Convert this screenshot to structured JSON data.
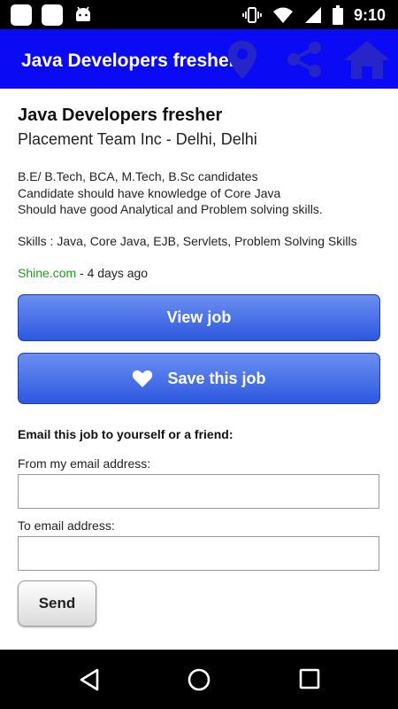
{
  "status_bar": {
    "time": "9:10",
    "icons": [
      "notification-square-icon",
      "notification-square-icon",
      "android-icon",
      "vibrate-icon",
      "wifi-icon",
      "signal-icon",
      "battery-icon"
    ]
  },
  "app_bar": {
    "title": "Java Developers fresher",
    "background": "#0a0af5",
    "icon_color": "#2525c8",
    "actions": [
      "location-icon",
      "share-icon",
      "home-icon"
    ]
  },
  "job": {
    "title": "Java Developers fresher",
    "company_location": "Placement Team Inc - Delhi, Delhi",
    "description_lines": [
      "B.E/ B.Tech, BCA, M.Tech, B.Sc candidates",
      "Candidate should have knowledge of Core Java",
      "Should have good Analytical and Problem solving skills."
    ],
    "skills": "Skills : Java, Core Java, EJB, Servlets, Problem Solving Skills",
    "source": "Shine.com",
    "posted": " - 4 days ago",
    "source_color": "#1f9d1f"
  },
  "buttons": {
    "view_job": "View job",
    "save_job": "Save this job",
    "send": "Send"
  },
  "email_form": {
    "heading": "Email this job to yourself or a friend:",
    "from_label": "From my email address:",
    "from_value": "",
    "to_label": "To email address:",
    "to_value": ""
  },
  "nav_bar": {
    "icons": [
      "back-icon",
      "home-circle-icon",
      "recent-apps-icon"
    ]
  }
}
